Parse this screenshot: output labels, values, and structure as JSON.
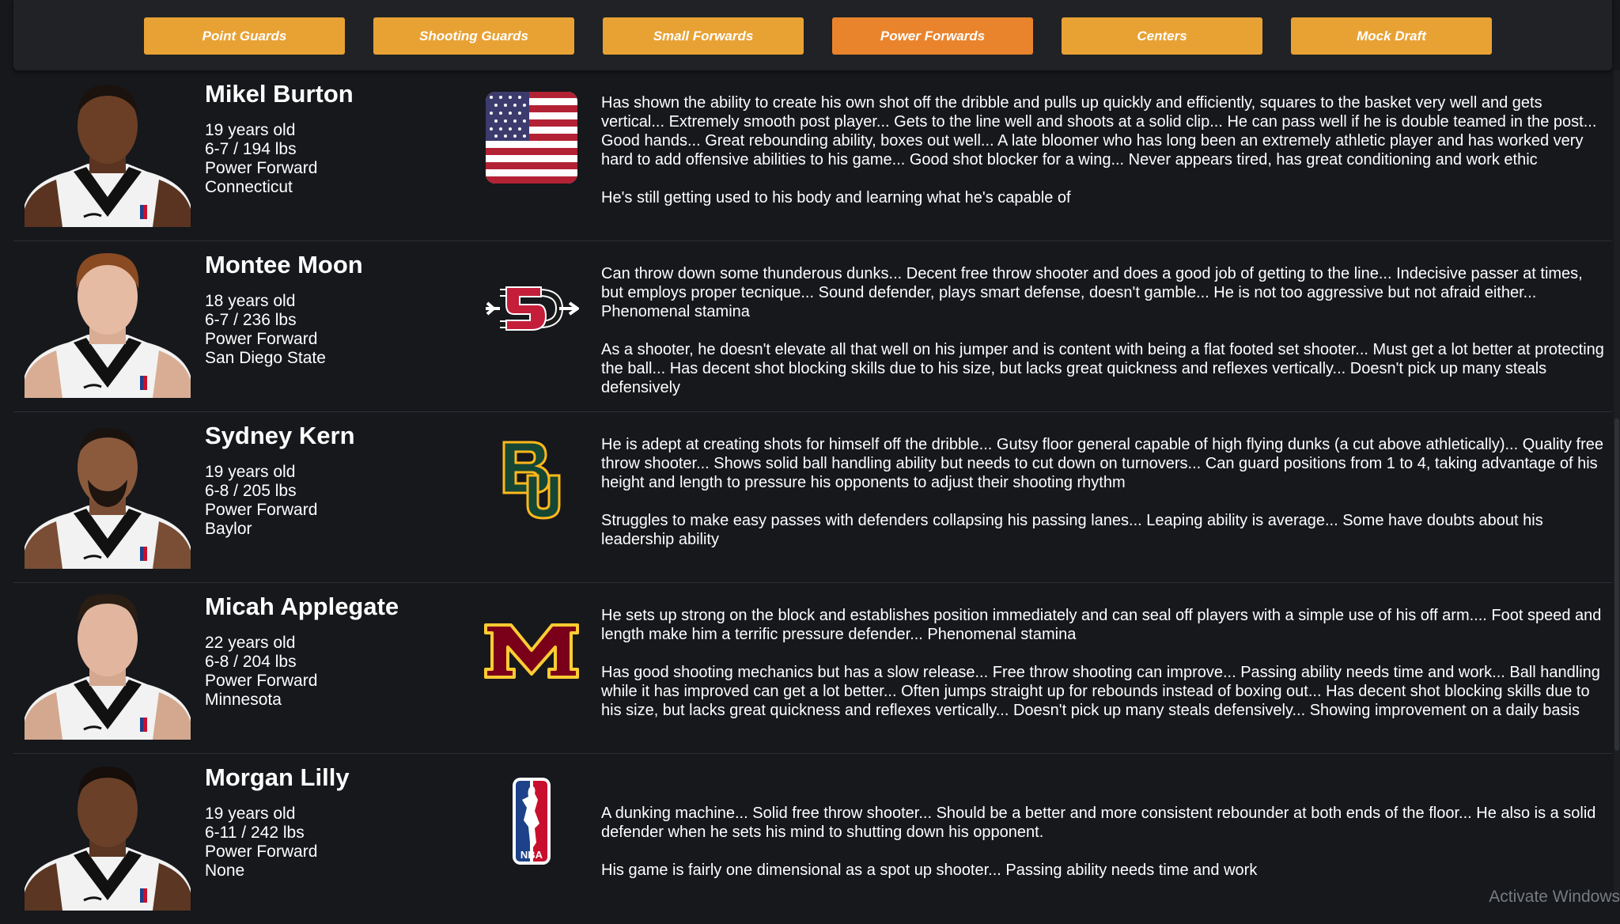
{
  "nav": {
    "items": [
      {
        "label": "Point Guards",
        "active": false
      },
      {
        "label": "Shooting Guards",
        "active": false
      },
      {
        "label": "Small Forwards",
        "active": false
      },
      {
        "label": "Power Forwards",
        "active": true
      },
      {
        "label": "Centers",
        "active": false
      },
      {
        "label": "Mock Draft",
        "active": false
      }
    ]
  },
  "colors": {
    "nav_button": "#e8a234",
    "nav_button_active": "#ea842c",
    "background": "#16181c"
  },
  "players": [
    {
      "name": "Mikel Burton",
      "age": "19 years old",
      "size": "6-7 / 194 lbs",
      "position": "Power Forward",
      "school": "Connecticut",
      "logo_icon": "usa-flag-icon",
      "strengths": "Has shown the ability to create his own shot off the dribble and pulls up quickly and efficiently, squares to the basket very well and gets vertical... Extremely smooth post player... Gets to the line well and shoots at a solid clip... He can pass well if he is double teamed in the post... Good hands... Great rebounding ability, boxes out well... A late bloomer who has long been an extremely athletic player and has worked very hard to add offensive abilities to his game... Good shot blocker for a wing... Never appears tired, has great conditioning and work ethic",
      "weaknesses": "He's still getting used to his body and learning what he's capable of"
    },
    {
      "name": "Montee Moon",
      "age": "18 years old",
      "size": "6-7 / 236 lbs",
      "position": "Power Forward",
      "school": "San Diego State",
      "logo_icon": "san-diego-state-logo-icon",
      "strengths": "Can throw down some thunderous dunks... Decent free throw shooter and does a good job of getting to the line... Indecisive passer at times, but employs proper tecnique... Sound defender, plays smart defense, doesn't gamble... He is not too aggressive but not afraid either... Phenomenal stamina",
      "weaknesses": "As a shooter, he doesn't elevate all that well on his jumper and is content with being a flat footed set shooter... Must get a lot better at protecting the ball... Has decent shot blocking skills due to his size, but lacks great quickness and reflexes vertically... Doesn't pick up many steals defensively"
    },
    {
      "name": "Sydney Kern",
      "age": "19 years old",
      "size": "6-8 / 205 lbs",
      "position": "Power Forward",
      "school": "Baylor",
      "logo_icon": "baylor-logo-icon",
      "strengths": "He is adept at creating shots for himself off the dribble... Gutsy floor general capable of high flying dunks (a cut above athletically)... Quality free throw shooter... Shows solid ball handling ability but needs to cut down on turnovers... Can guard positions from 1 to 4, taking advantage of his height and length to pressure his opponents to adjust their shooting rhythm",
      "weaknesses": "Struggles to make easy passes with defenders collapsing his passing lanes... Leaping ability is average... Some have doubts about his leadership ability"
    },
    {
      "name": "Micah Applegate",
      "age": "22 years old",
      "size": "6-8 / 204 lbs",
      "position": "Power Forward",
      "school": "Minnesota",
      "logo_icon": "minnesota-logo-icon",
      "strengths": "He sets up strong on the block and establishes position immediately and can seal off players with a simple use of his off arm.... Foot speed and length make him a terrific pressure defender... Phenomenal stamina",
      "weaknesses": "Has good shooting mechanics but has a slow release... Free throw shooting can improve... Passing ability needs time and work... Ball handling while it has improved can get a lot better... Often jumps straight up for rebounds instead of boxing out... Has decent shot blocking skills due to his size, but lacks great quickness and reflexes vertically... Doesn't pick up many steals defensively... Showing improvement on a daily basis"
    },
    {
      "name": "Morgan Lilly",
      "age": "19 years old",
      "size": "6-11 / 242 lbs",
      "position": "Power Forward",
      "school": "None",
      "logo_icon": "nba-logo-icon",
      "logo_text": "NBA",
      "strengths": "A dunking machine... Solid free throw shooter... Should be a better and more consistent rebounder at both ends of the floor... He also is a solid defender when he sets his mind to shutting down his opponent.",
      "weaknesses": "His game is fairly one dimensional as a spot up shooter... Passing ability needs time and work"
    }
  ],
  "watermark": "Activate Windows"
}
